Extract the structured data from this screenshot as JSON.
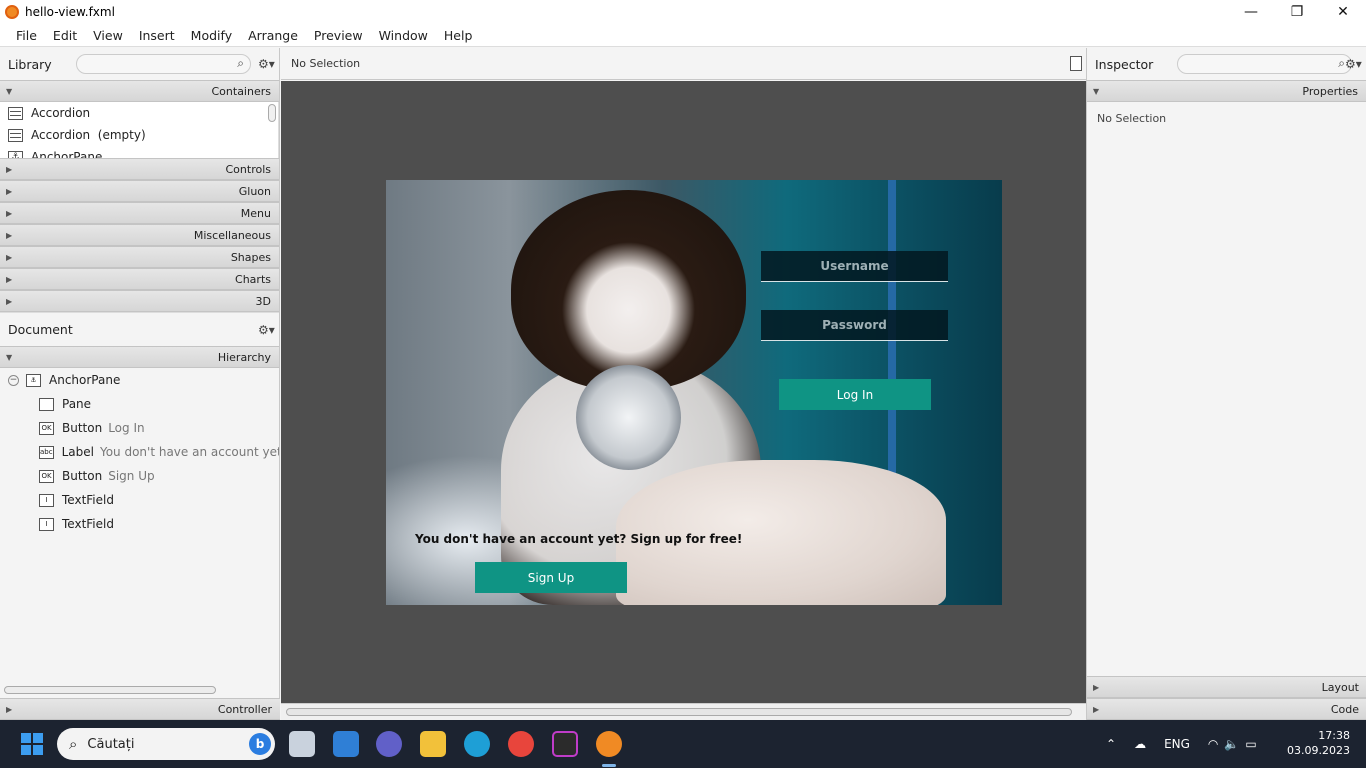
{
  "window": {
    "title": "hello-view.fxml",
    "minimize": "—",
    "maximize": "❐",
    "close": "✕"
  },
  "menu": [
    "File",
    "Edit",
    "View",
    "Insert",
    "Modify",
    "Arrange",
    "Preview",
    "Window",
    "Help"
  ],
  "library": {
    "title": "Library",
    "sections": {
      "containers": "Containers",
      "controls": "Controls",
      "gluon": "Gluon",
      "menu": "Menu",
      "misc": "Miscellaneous",
      "shapes": "Shapes",
      "charts": "Charts",
      "threed": "3D"
    },
    "items": [
      "Accordion",
      "Accordion  (empty)",
      "AnchorPane"
    ]
  },
  "document": {
    "title": "Document",
    "hierarchy_label": "Hierarchy",
    "controller_label": "Controller",
    "tree": [
      {
        "type": "AnchorPane",
        "text": "",
        "icon": "⚓"
      },
      {
        "type": "Pane",
        "text": "",
        "icon": ""
      },
      {
        "type": "Button",
        "text": "Log In",
        "icon": "OK"
      },
      {
        "type": "Label",
        "text": "You don't have an account yet? Sign up for free!",
        "icon": "abc"
      },
      {
        "type": "Button",
        "text": "Sign Up",
        "icon": "OK"
      },
      {
        "type": "TextField",
        "text": "",
        "icon": "I"
      },
      {
        "type": "TextField",
        "text": "",
        "icon": "I"
      }
    ]
  },
  "center": {
    "selection": "No Selection"
  },
  "design": {
    "username_prompt": "Username",
    "password_prompt": "Password",
    "login_label": "Log In",
    "signup_text": "You don't have an account yet? Sign up for free!",
    "signup_label": "Sign Up",
    "accent": "#0f9484"
  },
  "inspector": {
    "title": "Inspector",
    "properties": "Properties",
    "selection": "No Selection",
    "layout": "Layout",
    "code": "Code"
  },
  "taskbar": {
    "search_placeholder": "Căutați",
    "lang": "ENG",
    "time": "17:38",
    "date": "03.09.2023"
  }
}
